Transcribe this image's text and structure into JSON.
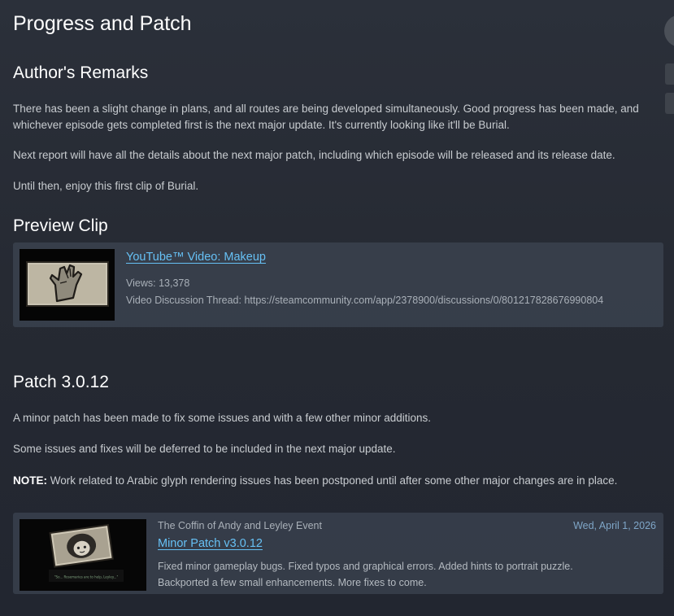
{
  "page": {
    "title": "Progress and Patch"
  },
  "remarks": {
    "heading": "Author's Remarks",
    "paragraph1_line1": "There has been a slight change in plans, and all routes are being developed simultaneously. Good progress has been made, and",
    "paragraph1_line2": "whichever episode gets completed first is the next major update. It's currently looking like it'll be Burial.",
    "paragraph2": "Next report will have all the details about the next major patch, including which episode will be released and its release date.",
    "paragraph3": "Until then, enjoy this first clip of Burial."
  },
  "preview": {
    "heading": "Preview Clip",
    "video_title": "YouTube™ Video: Makeup",
    "views": "Views: 13,378",
    "discussion": "Video Discussion Thread: https://steamcommunity.com/app/2378900/discussions/0/801217828676990804"
  },
  "patch": {
    "heading": "Patch 3.0.12",
    "paragraph1": "A minor patch has been made to fix some issues and with a few other minor additions.",
    "paragraph2": "Some issues and fixes will be deferred to be included in the next major update.",
    "note_label": "NOTE:",
    "note_text": " Work related to Arabic glyph rendering issues has been postponed until after some other major changes are in place."
  },
  "event": {
    "source": "The Coffin of Andy and Leyley Event",
    "date": "Wed, April 1, 2026",
    "title": "Minor Patch v3.0.12",
    "desc_line1": "Fixed minor gameplay bugs. Fixed typos and graphical errors. Added hints to portrait puzzle.",
    "desc_line2": "Backported a few small enhancements. More fixes to come.",
    "thumb_caption": "\"So... Rosemaries are to help, Leyley...\""
  },
  "colors": {
    "link": "#66c0f4",
    "background": "#262a33",
    "card": "#3a404b"
  }
}
